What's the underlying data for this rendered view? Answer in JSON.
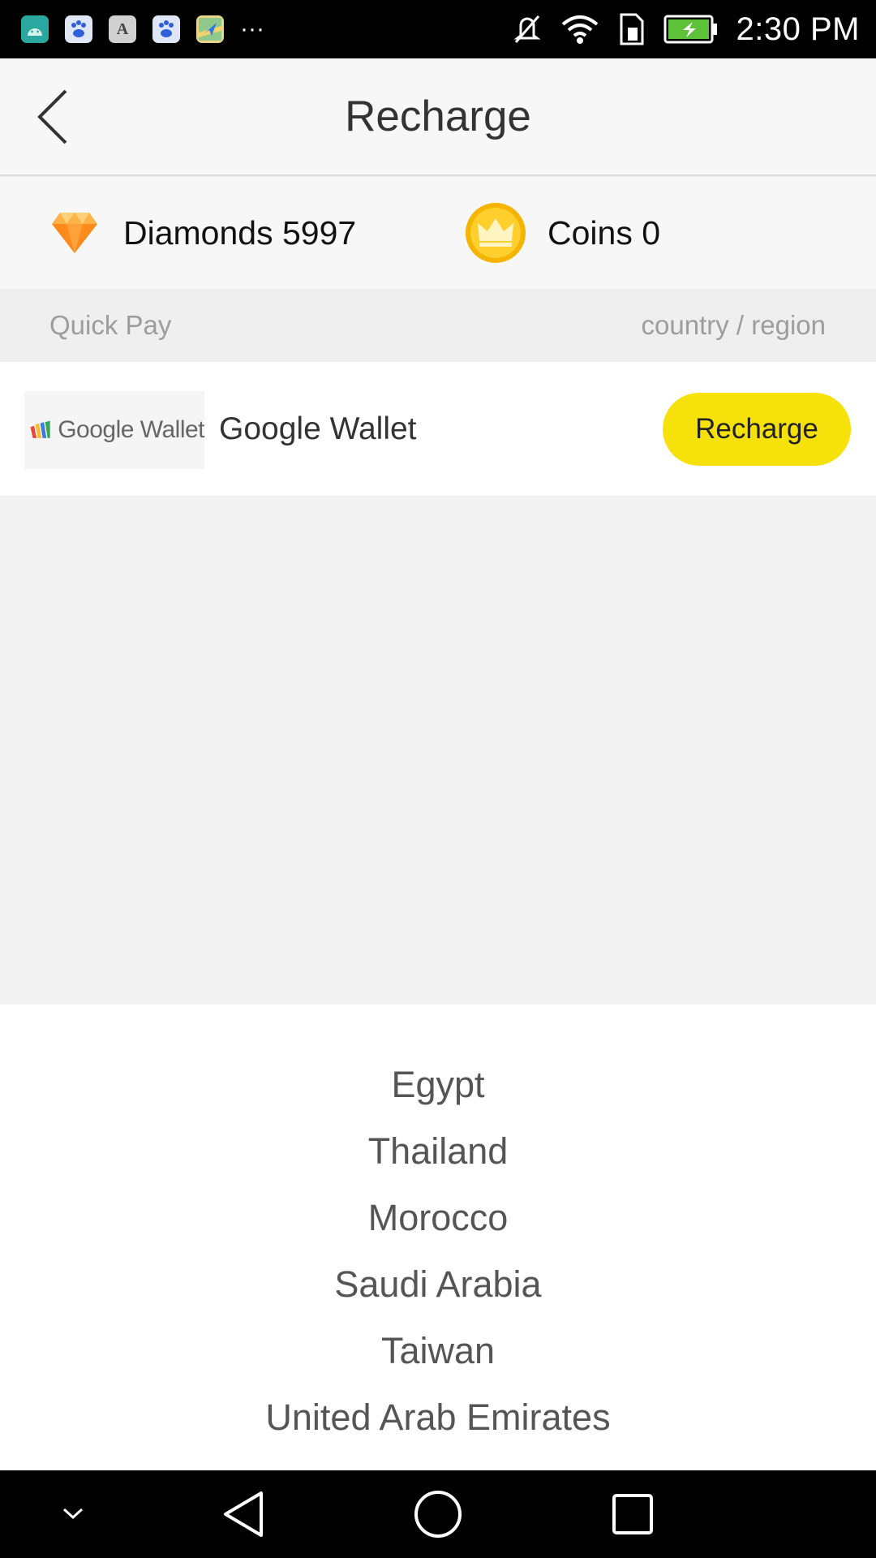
{
  "status_bar": {
    "time": "2:30 PM",
    "notification_icons": [
      "android-icon",
      "baidu-icon",
      "font-a-icon",
      "baidu-icon",
      "maps-icon"
    ],
    "overflow": "···"
  },
  "header": {
    "title": "Recharge"
  },
  "balance": {
    "diamonds_label": "Diamonds 5997",
    "coins_label": "Coins 0"
  },
  "section": {
    "left_label": "Quick Pay",
    "right_label": "country / region"
  },
  "payment": {
    "logo_text": "Google Wallet",
    "name": "Google Wallet",
    "button_label": "Recharge"
  },
  "country_picker": {
    "items": [
      "Egypt",
      "Thailand",
      "Morocco",
      "Saudi Arabia",
      "Taiwan",
      "United Arab Emirates"
    ]
  },
  "colors": {
    "accent_yellow": "#f7e10a",
    "diamond_orange": "#ffa62b",
    "coin_gold": "#f5b400"
  }
}
